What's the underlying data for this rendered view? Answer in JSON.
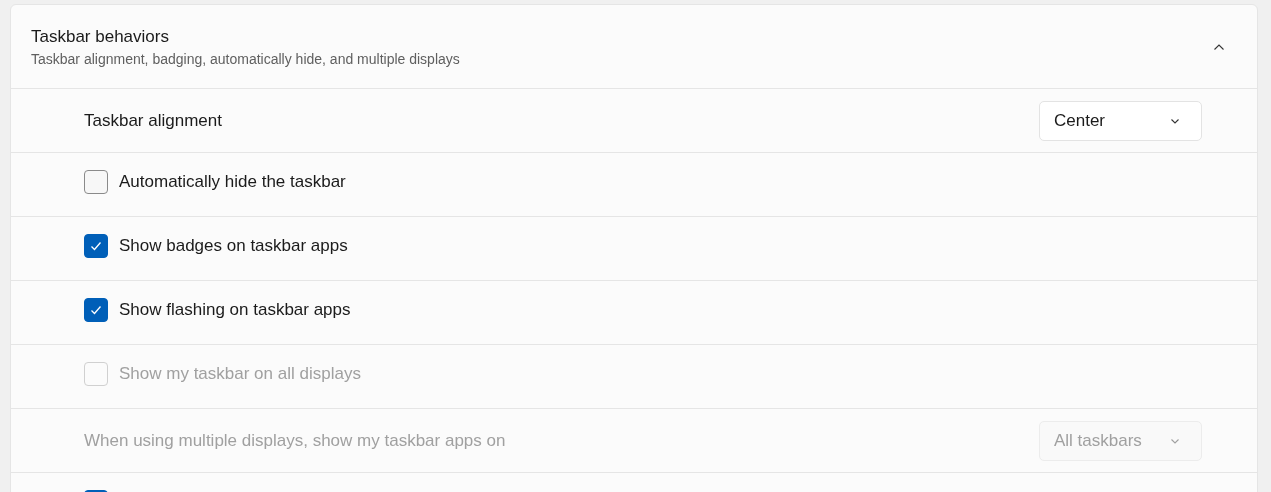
{
  "section": {
    "title": "Taskbar behaviors",
    "subtitle": "Taskbar alignment, badging, automatically hide, and multiple displays",
    "expanded": true
  },
  "rows": [
    {
      "kind": "dropdown",
      "label": "Taskbar alignment",
      "value": "Center",
      "disabled": false
    },
    {
      "kind": "checkbox",
      "label": "Automatically hide the taskbar",
      "checked": false,
      "disabled": false
    },
    {
      "kind": "checkbox",
      "label": "Show badges on taskbar apps",
      "checked": true,
      "disabled": false
    },
    {
      "kind": "checkbox",
      "label": "Show flashing on taskbar apps",
      "checked": true,
      "disabled": false
    },
    {
      "kind": "checkbox",
      "label": "Show my taskbar on all displays",
      "checked": false,
      "disabled": true
    },
    {
      "kind": "dropdown",
      "label": "When using multiple displays, show my taskbar apps on",
      "value": "All taskbars",
      "disabled": true
    },
    {
      "kind": "checkbox",
      "checked": true,
      "disabled": false
    }
  ]
}
